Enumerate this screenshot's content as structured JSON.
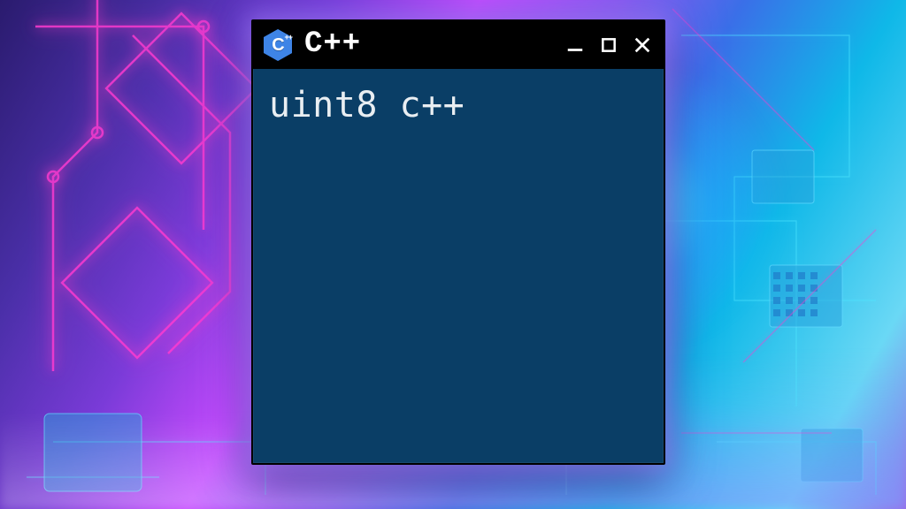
{
  "window": {
    "title": "C++",
    "icon_name": "cpp-logo-icon",
    "controls": {
      "minimize_label": "Minimize",
      "maximize_label": "Maximize",
      "close_label": "Close"
    }
  },
  "content": {
    "line1": "uint8 c++"
  },
  "colors": {
    "titlebar_bg": "#000000",
    "content_bg": "#0a3e66",
    "icon_fill": "#3e84e6",
    "text": "#e9eef2"
  }
}
